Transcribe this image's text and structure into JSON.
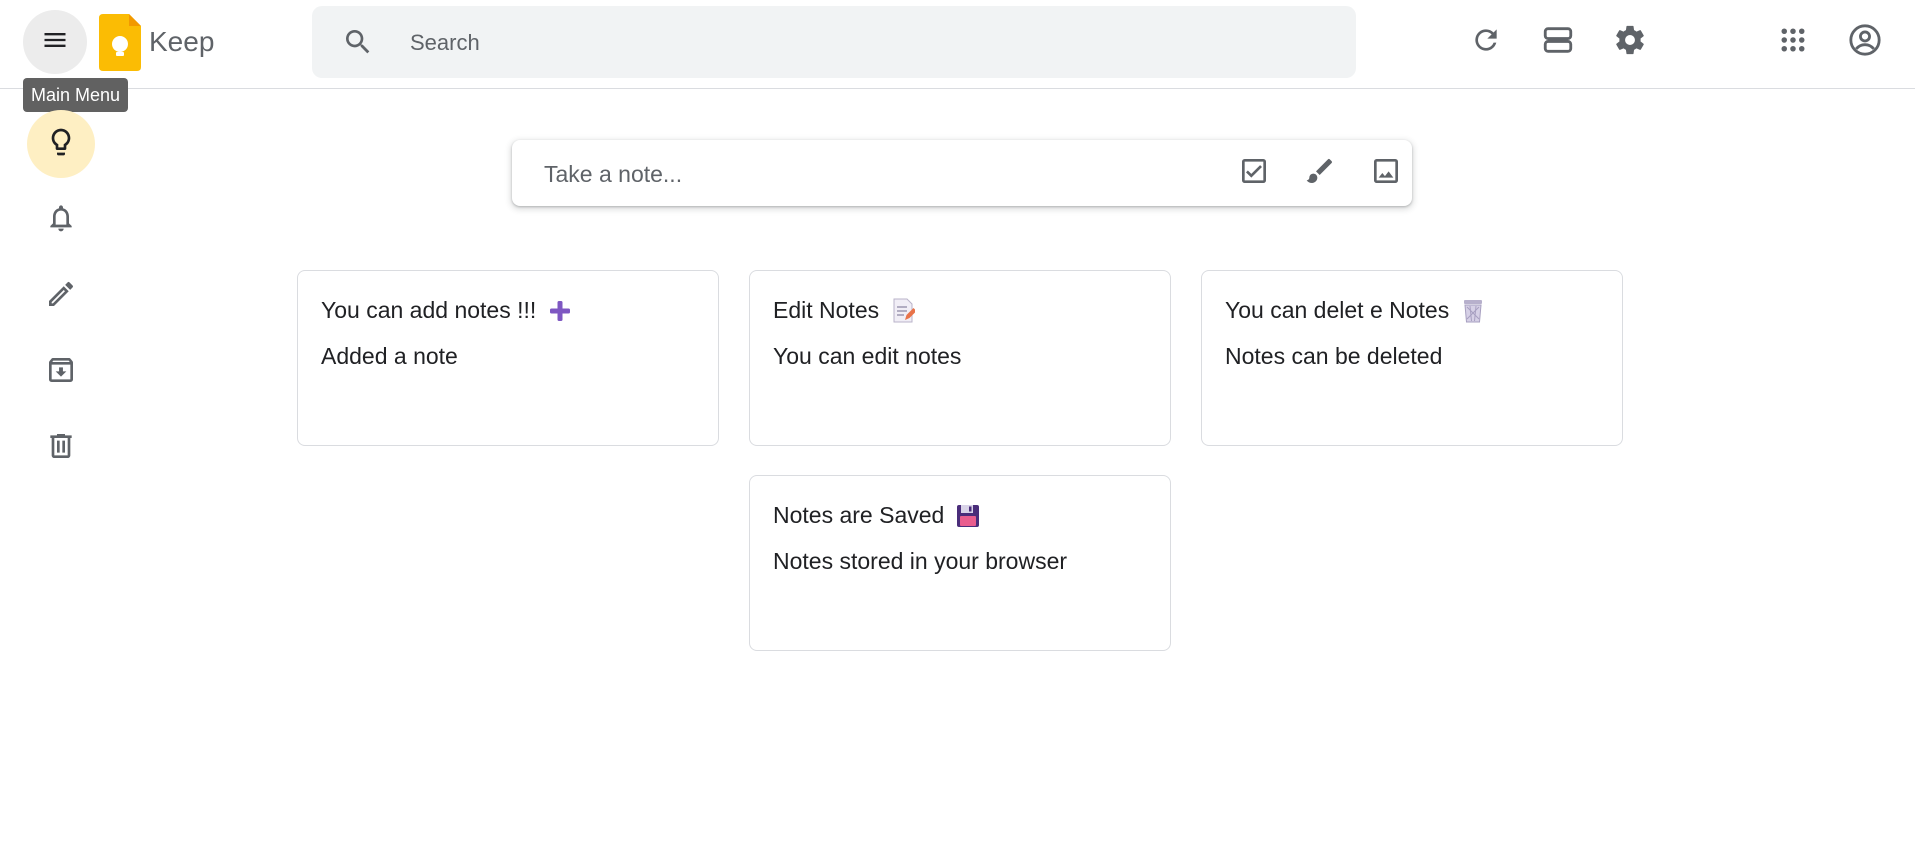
{
  "app": {
    "name": "Keep",
    "accent_color": "#fbbc04",
    "active_nav_color": "#feefc3"
  },
  "header": {
    "menu_icon": "hamburger-menu-icon",
    "menu_tooltip": "Main Menu",
    "search": {
      "placeholder": "Search",
      "value": "",
      "icon": "search-icon"
    },
    "actions": [
      {
        "name": "refresh",
        "icon": "refresh-icon"
      },
      {
        "name": "list-view",
        "icon": "list-view-icon"
      },
      {
        "name": "settings",
        "icon": "gear-icon"
      },
      {
        "name": "apps",
        "icon": "apps-grid-icon"
      },
      {
        "name": "account",
        "icon": "account-circle-icon"
      }
    ]
  },
  "sidebar": {
    "items": [
      {
        "name": "notes",
        "icon": "lightbulb-icon",
        "active": true
      },
      {
        "name": "reminders",
        "icon": "bell-icon",
        "active": false
      },
      {
        "name": "edit-labels",
        "icon": "pencil-icon",
        "active": false
      },
      {
        "name": "archive",
        "icon": "archive-icon",
        "active": false
      },
      {
        "name": "trash",
        "icon": "trash-icon",
        "active": false
      }
    ]
  },
  "take_note": {
    "placeholder": "Take a note...",
    "value": "",
    "actions": [
      {
        "name": "new-list",
        "icon": "checkbox-icon"
      },
      {
        "name": "new-drawing",
        "icon": "brush-icon"
      },
      {
        "name": "new-image",
        "icon": "image-icon"
      }
    ]
  },
  "notes": [
    {
      "title": "You can add notes !!!",
      "emoji": "heavy-plus-icon",
      "body": "Added a note"
    },
    {
      "title": "Edit Notes",
      "emoji": "memo-icon",
      "body": "You can edit notes"
    },
    {
      "title": "You can delet e Notes",
      "emoji": "wastebasket-icon",
      "body": "Notes can be deleted"
    },
    {
      "title": "Notes are Saved",
      "emoji": "floppy-disk-icon",
      "body": "Notes stored in your browser"
    }
  ]
}
